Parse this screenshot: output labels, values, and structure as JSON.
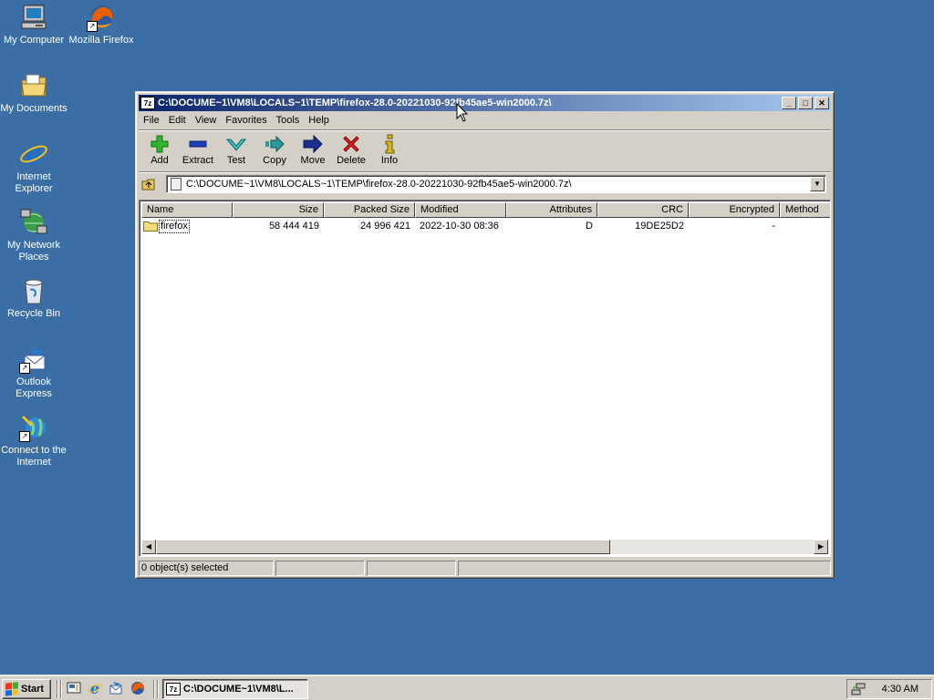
{
  "desktop": {
    "icons": [
      {
        "label": "My Computer",
        "icon": "my-computer-icon"
      },
      {
        "label": "Mozilla Firefox",
        "icon": "firefox-icon"
      },
      {
        "label": "My Documents",
        "icon": "my-documents-icon"
      },
      {
        "label": "Internet Explorer",
        "icon": "internet-explorer-icon"
      },
      {
        "label": "My Network Places",
        "icon": "network-places-icon"
      },
      {
        "label": "Recycle Bin",
        "icon": "recycle-bin-icon"
      },
      {
        "label": "Outlook Express",
        "icon": "outlook-express-icon"
      },
      {
        "label": "Connect to the Internet",
        "icon": "connect-internet-icon"
      }
    ]
  },
  "window": {
    "app_badge": "7z",
    "title": "C:\\DOCUME~1\\VM8\\LOCALS~1\\TEMP\\firefox-28.0-20221030-92fb45ae5-win2000.7z\\",
    "controls": {
      "minimize": "_",
      "maximize": "□",
      "close": "✕"
    },
    "menu": [
      "File",
      "Edit",
      "View",
      "Favorites",
      "Tools",
      "Help"
    ],
    "toolbar": [
      {
        "label": "Add",
        "icon": "plus-icon"
      },
      {
        "label": "Extract",
        "icon": "minus-icon"
      },
      {
        "label": "Test",
        "icon": "check-icon"
      },
      {
        "label": "Copy",
        "icon": "copy-arrow-icon"
      },
      {
        "label": "Move",
        "icon": "move-arrow-icon"
      },
      {
        "label": "Delete",
        "icon": "delete-x-icon"
      },
      {
        "label": "Info",
        "icon": "info-icon"
      }
    ],
    "address": {
      "path": "C:\\DOCUME~1\\VM8\\LOCALS~1\\TEMP\\firefox-28.0-20221030-92fb45ae5-win2000.7z\\",
      "dropdown": "▼"
    },
    "columns": [
      "Name",
      "Size",
      "Packed Size",
      "Modified",
      "Attributes",
      "CRC",
      "Encrypted",
      "Method"
    ],
    "rows": [
      {
        "name": "firefox",
        "size": "58 444 419",
        "packed_size": "24 996 421",
        "modified": "2022-10-30 08:36",
        "attributes": "D",
        "crc": "19DE25D2",
        "encrypted": "-",
        "method": ""
      }
    ],
    "scroll": {
      "left": "◀",
      "right": "▶"
    },
    "status": [
      "0 object(s) selected",
      "",
      "",
      ""
    ]
  },
  "taskbar": {
    "start_label": "Start",
    "quick_launch": [
      "show-desktop-icon",
      "internet-explorer-icon",
      "outlook-express-icon",
      "firefox-icon"
    ],
    "task_badge": "7z",
    "task_title": "C:\\DOCUME~1\\VM8\\L...",
    "clock": "4:30 AM"
  },
  "colors": {
    "desktop": "#3a6ea5",
    "title_active_start": "#0a246a",
    "title_active_end": "#a6caf0",
    "face": "#d4d0c8"
  }
}
